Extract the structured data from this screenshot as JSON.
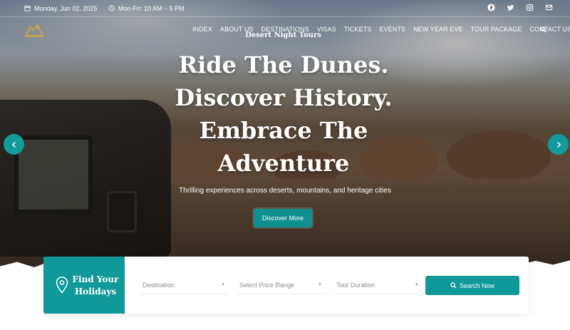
{
  "topbar": {
    "date": "Monday, Jun 02, 2025",
    "hours": "Mon-Fri: 10 AM – 5 PM",
    "social_icons": [
      "facebook-icon",
      "twitter-icon",
      "instagram-icon",
      "email-icon"
    ]
  },
  "nav": {
    "items": [
      "INDEX",
      "ABOUT US",
      "DESTINATIONS",
      "VISAS",
      "TICKETS",
      "EVENTS",
      "NEW YEAR EVE",
      "TOUR PACKAGE",
      "CONTACT US"
    ]
  },
  "hero": {
    "brand": "Desert Night Tours",
    "headline_lines": [
      "Ride The Dunes.",
      "Discover History.",
      "Embrace The",
      "Adventure"
    ],
    "subline": "Thrilling experiences across deserts, mountains, and heritage cities",
    "cta_label": "Discover More"
  },
  "search": {
    "title_line1": "Find Your",
    "title_line2": "Holidays",
    "destination_placeholder": "Destination",
    "price_placeholder": "Select Price Range",
    "duration_placeholder": "Tour Duration",
    "button_label": "Search Now"
  },
  "colors": {
    "accent": "#109999",
    "text_light": "#ffffff",
    "placeholder": "#8b8b8b"
  }
}
